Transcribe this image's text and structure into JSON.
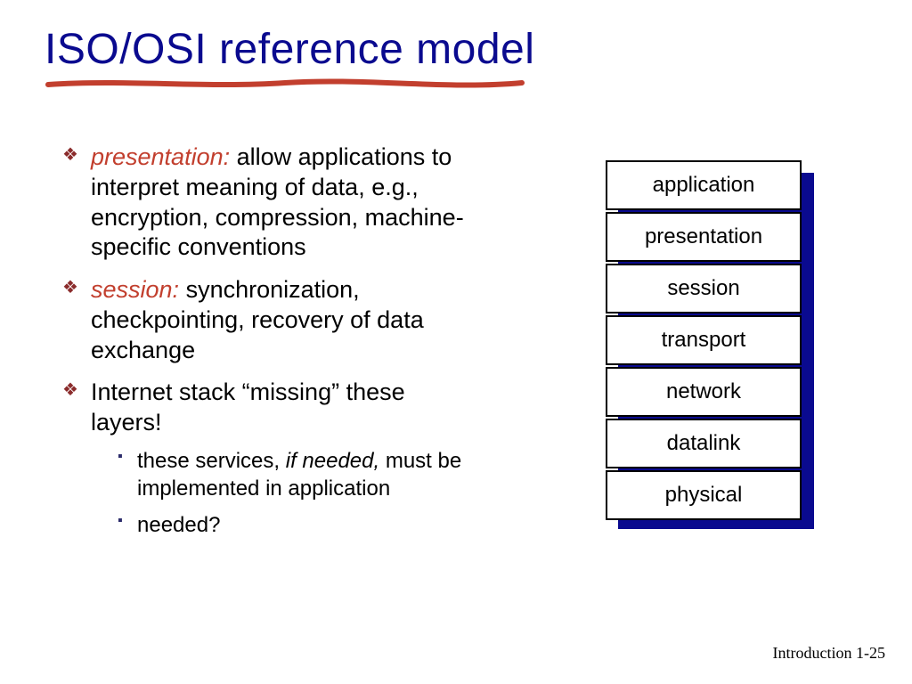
{
  "title": "ISO/OSI reference model",
  "bullets": {
    "b1_kw": "presentation:",
    "b1_rest": " allow applications to interpret meaning of data, e.g., encryption, compression, machine-specific conventions",
    "b2_kw": "session:",
    "b2_rest": " synchronization, checkpointing, recovery of data exchange",
    "b3": "Internet stack “missing” these layers!",
    "sub1_pre": "these services, ",
    "sub1_em": "if needed,",
    "sub1_post": " must be implemented in application",
    "sub2": "needed?"
  },
  "layers": {
    "l0": "application",
    "l1": "presentation",
    "l2": "session",
    "l3": "transport",
    "l4": "network",
    "l5": "datalink",
    "l6": "physical"
  },
  "footer_label": "Introduction",
  "footer_page": "1-25"
}
